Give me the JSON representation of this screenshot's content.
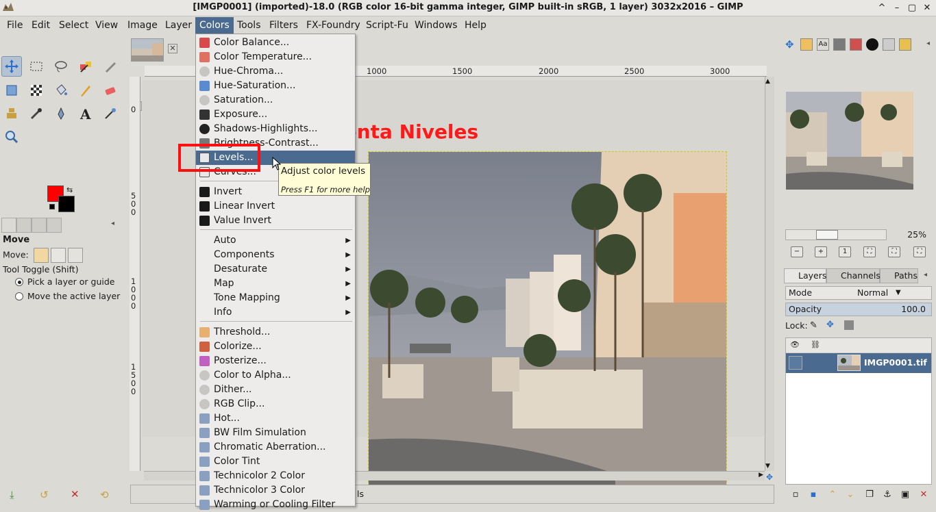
{
  "window": {
    "title": "[IMGP0001] (imported)-18.0 (RGB color 16-bit gamma integer, GIMP built-in sRGB, 1 layer) 3032x2016 – GIMP",
    "controls": [
      "^",
      "–",
      "▢",
      "✕"
    ]
  },
  "menubar": [
    "File",
    "Edit",
    "Select",
    "View",
    "Image",
    "Layer",
    "Colors",
    "Tools",
    "Filters",
    "FX-Foundry",
    "Script-Fu",
    "Windows",
    "Help"
  ],
  "colors_menu": {
    "items": [
      {
        "label": "Color Balance..."
      },
      {
        "label": "Color Temperature..."
      },
      {
        "label": "Hue-Chroma..."
      },
      {
        "label": "Hue-Saturation..."
      },
      {
        "label": "Saturation..."
      },
      {
        "label": "Exposure..."
      },
      {
        "label": "Shadows-Highlights..."
      },
      {
        "label": "Brightness-Contrast..."
      },
      {
        "label": "Levels..."
      },
      {
        "label": "Curves..."
      },
      {
        "label": "Invert"
      },
      {
        "label": "Linear Invert"
      },
      {
        "label": "Value Invert"
      },
      {
        "label": "Auto"
      },
      {
        "label": "Components"
      },
      {
        "label": "Desaturate"
      },
      {
        "label": "Map"
      },
      {
        "label": "Tone Mapping"
      },
      {
        "label": "Info"
      },
      {
        "label": "Threshold..."
      },
      {
        "label": "Colorize..."
      },
      {
        "label": "Posterize..."
      },
      {
        "label": "Color to Alpha..."
      },
      {
        "label": "Dither..."
      },
      {
        "label": "RGB Clip..."
      },
      {
        "label": "Hot..."
      },
      {
        "label": "BW Film Simulation"
      },
      {
        "label": "Chromatic Aberration..."
      },
      {
        "label": "Color Tint"
      },
      {
        "label": "Technicolor 2 Color"
      },
      {
        "label": "Technicolor 3 Color"
      },
      {
        "label": "Warming or Cooling Filter"
      }
    ]
  },
  "tooltip": {
    "title": "Adjust color levels",
    "hint": "Press F1 for more help"
  },
  "annotation": "Herramienta Niveles",
  "tool_options": {
    "heading": "Move",
    "move_label": "Move:",
    "toggle_label": "Tool Toggle  (Shift)",
    "option_pick": "Pick a layer or guide",
    "option_move": "Move the active layer"
  },
  "ruler": {
    "h_labels": [
      "1000",
      "1500",
      "2000",
      "2500",
      "3000"
    ],
    "v_labels": [
      "0",
      "5\n0\n0",
      "1\n0\n0\n0",
      "1\n5\n0\n0"
    ]
  },
  "status": {
    "text": "ls"
  },
  "navigator": {
    "zoom": "25%",
    "zoom_fraction": 0.25
  },
  "layers_panel": {
    "tabs": [
      "Layers",
      "Channels",
      "Paths"
    ],
    "mode_label": "Mode",
    "mode_value": "Normal",
    "opacity_label": "Opacity",
    "opacity_value": "100.0",
    "lock_label": "Lock:",
    "layer_name": "IMGP0001.tif"
  },
  "colors": {
    "fg": "#ff0000",
    "bg": "#000000",
    "highlight": "#4a6a8f",
    "annotation": "#ff1a1a"
  }
}
